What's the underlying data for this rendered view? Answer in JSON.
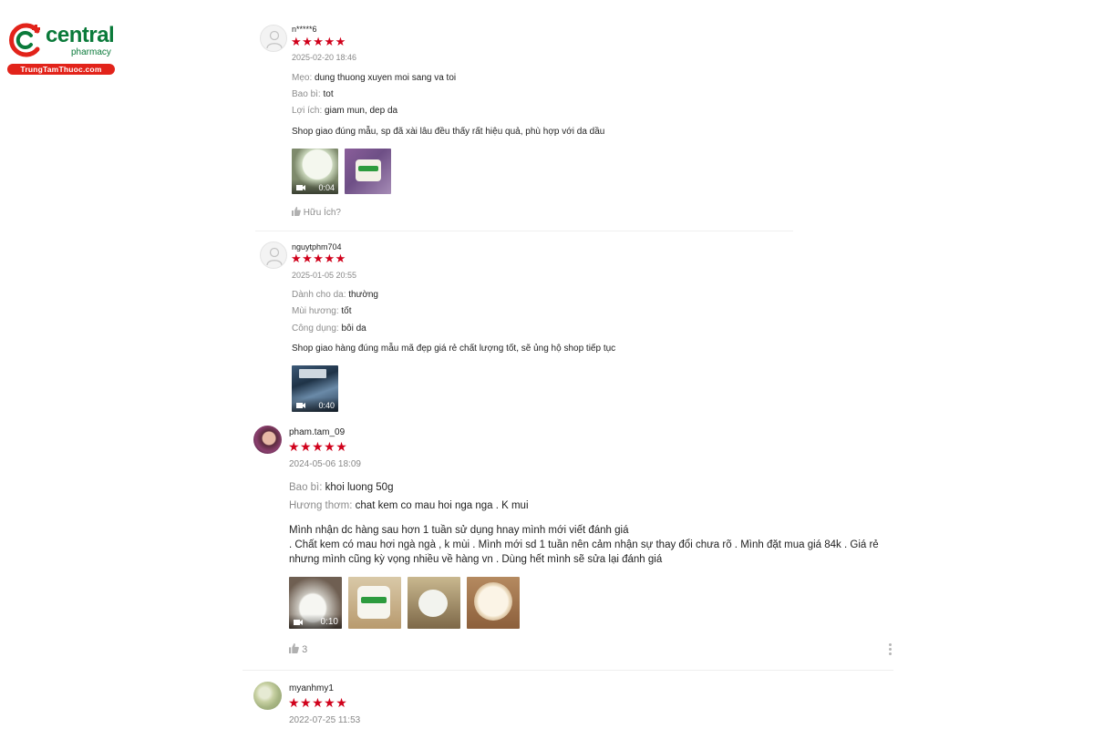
{
  "brand": {
    "name": "central",
    "sub": "pharmacy",
    "banner": "TrungTamThuoc.com",
    "green": "#0a7a3a",
    "red": "#e2231a"
  },
  "colors": {
    "star": "#d0011b",
    "muted": "#8c8c8c"
  },
  "reviews": [
    {
      "username": "n*****6",
      "stars": "★★★★★",
      "date": "2025-02-20 18:46",
      "attrs": [
        {
          "key": "Mẹo:",
          "value": "dung thuong xuyen moi sang va toi"
        },
        {
          "key": "Bao bì:",
          "value": "tot"
        },
        {
          "key": "Lợi ích:",
          "value": "giam mun, dep da"
        }
      ],
      "comment": "Shop giao đúng mẫu, sp đã xài lâu đều thấy rất hiệu quả, phù hợp với da dầu",
      "media": [
        {
          "type": "video",
          "duration": "0:04"
        },
        {
          "type": "image"
        }
      ],
      "helpful": "Hữu Ích?"
    },
    {
      "username": "nguytphm704",
      "stars": "★★★★★",
      "date": "2025-01-05 20:55",
      "attrs": [
        {
          "key": "Dành cho da:",
          "value": "thường"
        },
        {
          "key": "Mùi hương:",
          "value": "tốt"
        },
        {
          "key": "Công dụng:",
          "value": "bôi da"
        }
      ],
      "comment": "Shop giao hàng đúng mẫu mã đẹp giá rẻ chất lượng tốt, sẽ ủng hộ shop tiếp tục",
      "media": [
        {
          "type": "video",
          "duration": "0:40"
        }
      ]
    },
    {
      "username": "pham.tam_09",
      "stars": "★★★★★",
      "date": "2024-05-06 18:09",
      "attrs": [
        {
          "key": "Bao bì:",
          "value": "khoi luong 50g"
        },
        {
          "key": "Hương thơm:",
          "value": "chat kem co mau hoi nga nga . K mui"
        }
      ],
      "comment_lines": [
        "Mình nhận dc hàng sau hơn 1 tuần sử dụng hnay mình mới viết đánh giá",
        ". Chất kem có mau hơi ngà ngà , k mùi . Mình mới sd 1 tuần nên cảm nhận sự thay đổi chưa rõ . Mình đặt mua giá 84k . Giá rẻ",
        "nhưng mình cũng kỳ vọng nhiều về hàng vn . Dùng hết mình sẽ sửa lại đánh giá"
      ],
      "media": [
        {
          "type": "video",
          "duration": "0:10"
        },
        {
          "type": "image"
        },
        {
          "type": "image"
        },
        {
          "type": "image"
        }
      ],
      "likes": "3"
    },
    {
      "username": "myanhmy1",
      "stars": "★★★★★",
      "date": "2022-07-25 11:53"
    }
  ]
}
